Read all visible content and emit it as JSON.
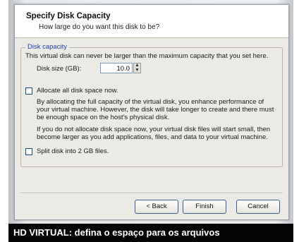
{
  "dialog": {
    "title": "Specify Disk Capacity",
    "subtitle": "How large do you want this disk to be?",
    "group_label": "Disk capacity",
    "intro_text": "This virtual disk can never be larger than the maximum capacity that you set here.",
    "disk_size_label": "Disk size (GB):",
    "disk_size_value": "10.0",
    "allocate_label": "Allocate all disk space now.",
    "allocate_desc_1": "By allocating the full capacity of the virtual disk, you enhance performance of",
    "allocate_desc_2": "your virtual machine.  However, the disk will take longer to create and there must",
    "allocate_desc_3": "be enough space on the host's physical disk.",
    "noalloc_desc_1": "If you do not allocate disk space now, your virtual disk files will start small, then",
    "noalloc_desc_2": "become larger as you add applications, files, and data to your virtual machine.",
    "split_label": "Split disk into 2 GB files.",
    "back_label": "< Back",
    "finish_label": "Finish",
    "cancel_label": "Cancel"
  },
  "caption": {
    "heading": "HD VIRTUAL:",
    "text": "defina o espaço para os arquivos"
  }
}
